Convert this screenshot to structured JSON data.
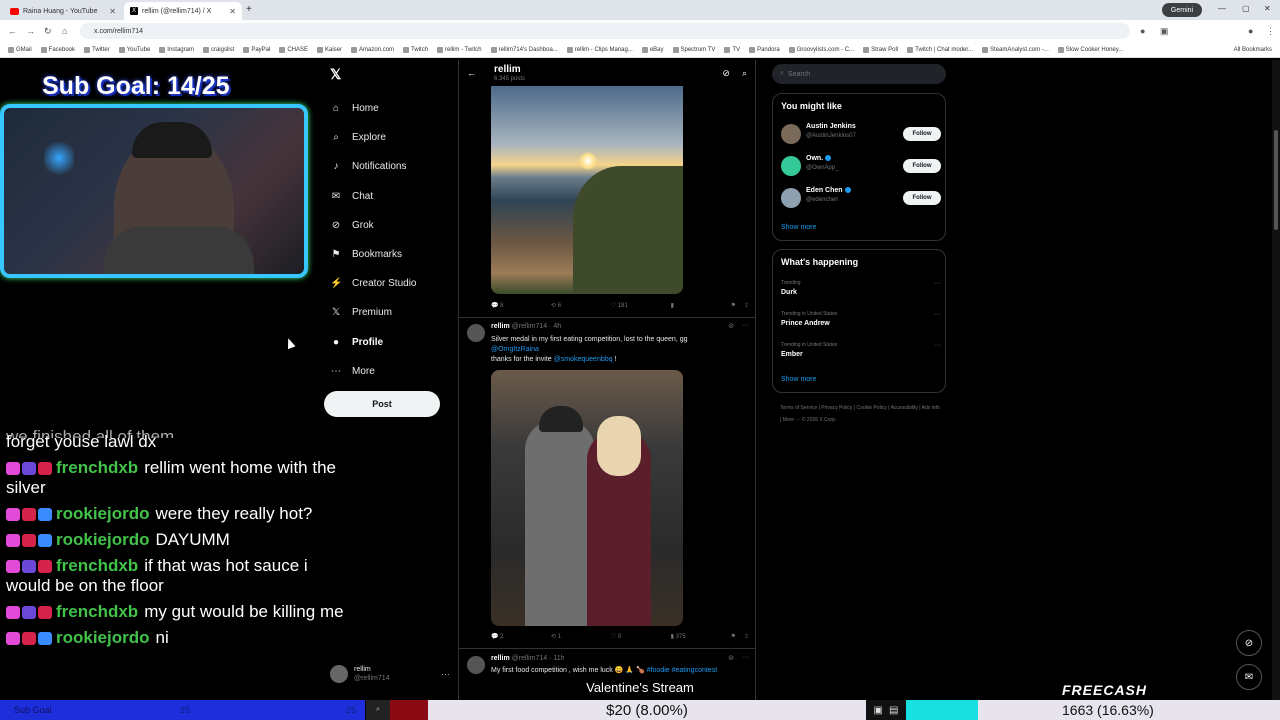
{
  "browser": {
    "tabs": [
      {
        "title": "Raina Huang - YouTube"
      },
      {
        "title": "rellim (@rellim714) / X"
      }
    ],
    "url": "x.com/rellim714",
    "gemini_label": "Gemini",
    "bookmarks": [
      "GMail",
      "Facebook",
      "Twitter",
      "YouTube",
      "Instagram",
      "craigslist",
      "PayPal",
      "CHASE",
      "Kaiser",
      "Amazon.com",
      "Twitch",
      "rellim - Twitch",
      "rellim714's Dashboa...",
      "rellim - Clips Manag...",
      "eBay",
      "Spectrum TV",
      "TV",
      "Pandora",
      "Groovylists.com - C...",
      "Straw Poll",
      "Twitch | Chat moder...",
      "SteamAnalyst.com -...",
      "Slow Cooker Honey..."
    ],
    "all_bookmarks": "All Bookmarks"
  },
  "stream": {
    "sub_goal": "Sub Goal: 14/25",
    "chat_clipped": "we finished all of them",
    "chat": [
      {
        "user": "",
        "msg": "forget youse lawl dx"
      },
      {
        "user": "frenchdxb",
        "msg": "rellim went home with the silver"
      },
      {
        "user": "rookiejordo",
        "msg": "were they really hot?"
      },
      {
        "user": "rookiejordo",
        "msg": "DAYUMM"
      },
      {
        "user": "frenchdxb",
        "msg": "if that was hot sauce i would be on the floor"
      },
      {
        "user": "frenchdxb",
        "msg": "my gut would be killing me"
      },
      {
        "user": "rookiejordo",
        "msg": "ni"
      }
    ],
    "valentine": "Valentine's Stream",
    "freecash": "FREECASH",
    "bottom": {
      "sub_goal_label": "Sub Goal",
      "sub_goal_current": "25",
      "sub_goal_target": "25",
      "money": "$20 (8.00%)",
      "right_value": "1663 (16.63%)"
    }
  },
  "x": {
    "nav": [
      {
        "label": "Home",
        "icon": "home-icon"
      },
      {
        "label": "Explore",
        "icon": "search-icon"
      },
      {
        "label": "Notifications",
        "icon": "bell-icon"
      },
      {
        "label": "Chat",
        "icon": "chat-icon"
      },
      {
        "label": "Grok",
        "icon": "grok-icon"
      },
      {
        "label": "Bookmarks",
        "icon": "bookmark-icon"
      },
      {
        "label": "Creator Studio",
        "icon": "creator-studio-icon"
      },
      {
        "label": "Premium",
        "icon": "x-premium-icon"
      },
      {
        "label": "Profile",
        "icon": "profile-icon"
      },
      {
        "label": "More",
        "icon": "more-icon"
      }
    ],
    "post_button": "Post",
    "account": {
      "name": "rellim",
      "handle": "@rellim714"
    },
    "profile": {
      "name": "rellim",
      "post_count": "6,345 posts"
    },
    "tweet1_stats": {
      "replies": "8",
      "reposts": "6",
      "likes": "181",
      "views": ""
    },
    "tweet2": {
      "name": "rellim",
      "handle": "@rellim714 · 4h",
      "text": "Silver medal in my first eating competition, lost to the queen, gg",
      "mention": "@OmgItzRaina",
      "text2": "thanks for the invite",
      "mention2": "@smokequeenbbq",
      "text3": "!",
      "stats": {
        "replies": "2",
        "reposts": "1",
        "likes": "0",
        "views": "375"
      }
    },
    "tweet3": {
      "name": "rellim",
      "handle": "@rellim714 · 11h",
      "text": "My first food competition , wish me luck 😀 🙏 🍗",
      "tags": "#foodie #eatingcontest"
    },
    "search_placeholder": "Search",
    "you_might_like": {
      "title": "You might like",
      "users": [
        {
          "name": "Austin Jenkins",
          "handle": "@AustinJenkins07",
          "follow": "Follow"
        },
        {
          "name": "Own.",
          "handle": "@OwnApp_",
          "follow": "Follow"
        },
        {
          "name": "Eden Chen",
          "handle": "@edenchen",
          "follow": "Follow"
        }
      ],
      "show_more": "Show more"
    },
    "whats_happening": {
      "title": "What's happening",
      "trends": [
        {
          "context": "Trending",
          "topic": "Durk"
        },
        {
          "context": "Trending in United States",
          "topic": "Prince Andrew"
        },
        {
          "context": "Trending in United States",
          "topic": "Ember"
        }
      ],
      "show_more": "Show more"
    },
    "footer": "Terms of Service | Privacy Policy | Cookie Policy | Accessibility | Ads info | More ··· © 2026 X Corp."
  }
}
